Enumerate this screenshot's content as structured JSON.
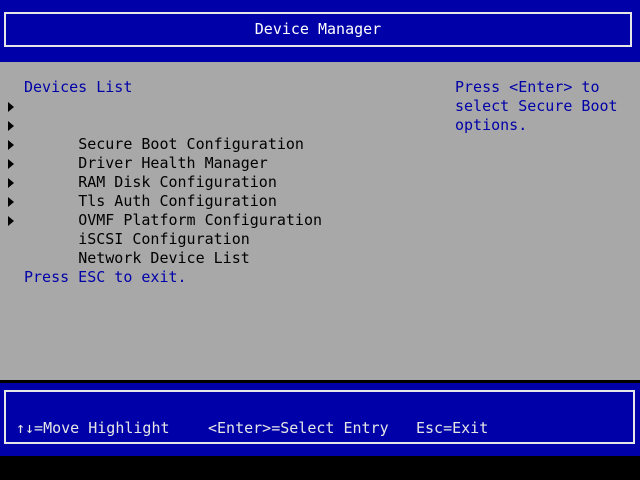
{
  "header": {
    "title": "Device Manager"
  },
  "devices": {
    "heading": "Devices List",
    "items": [
      {
        "label": "Secure Boot Configuration"
      },
      {
        "label": "Driver Health Manager"
      },
      {
        "label": "RAM Disk Configuration"
      },
      {
        "label": "Tls Auth Configuration"
      },
      {
        "label": "OVMF Platform Configuration"
      },
      {
        "label": "iSCSI Configuration"
      },
      {
        "label": "Network Device List"
      }
    ],
    "exit_hint": "Press ESC to exit."
  },
  "help": {
    "lines": [
      "Press <Enter> to",
      "select Secure Boot",
      "options."
    ]
  },
  "footer": {
    "move": "↑↓=Move Highlight",
    "select": "<Enter>=Select Entry",
    "exit": "Esc=Exit"
  },
  "colors": {
    "background_blue": "#0000a8",
    "panel_gray": "#a8a8a8",
    "header_text": "#ffffff",
    "link_text": "#0000a8"
  }
}
